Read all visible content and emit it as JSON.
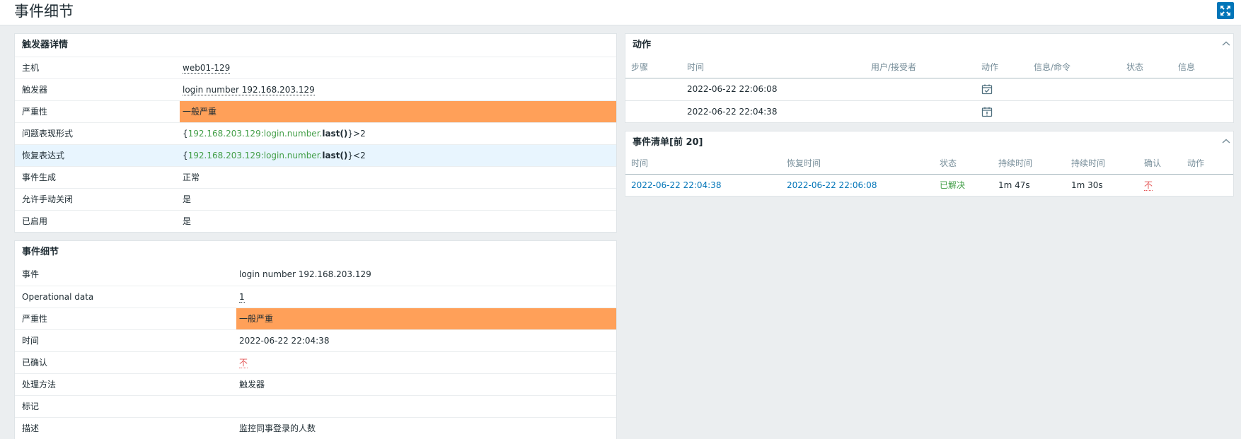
{
  "page": {
    "title": "事件细节"
  },
  "trigger_panel": {
    "title": "触发器详情",
    "rows": [
      {
        "label": "主机",
        "value": "web01-129"
      },
      {
        "label": "触发器",
        "value": "login number 192.168.203.129"
      },
      {
        "label": "严重性",
        "value": "一般严重"
      },
      {
        "label": "问题表现形式",
        "expr_open": "{",
        "expr_key": "192.168.203.129:login.number.",
        "expr_fn": "last()",
        "expr_tail": "}>2"
      },
      {
        "label": "恢复表达式",
        "expr_open": "{",
        "expr_key": "192.168.203.129:login.number.",
        "expr_fn": "last()",
        "expr_tail": "}<2"
      },
      {
        "label": "事件生成",
        "value": "正常"
      },
      {
        "label": "允许手动关闭",
        "value": "是"
      },
      {
        "label": "已启用",
        "value": "是"
      }
    ]
  },
  "event_panel": {
    "title": "事件细节",
    "rows": [
      {
        "label": "事件",
        "value": "login number 192.168.203.129"
      },
      {
        "label": "Operational data",
        "value": "1"
      },
      {
        "label": "严重性",
        "value": "一般严重"
      },
      {
        "label": "时间",
        "value": "2022-06-22 22:04:38"
      },
      {
        "label": "已确认",
        "value": "不"
      },
      {
        "label": "处理方法",
        "value": "触发器"
      },
      {
        "label": "标记",
        "value": ""
      },
      {
        "label": "描述",
        "value": "监控同事登录的人数"
      }
    ]
  },
  "actions_panel": {
    "title": "动作",
    "columns": [
      "步骤",
      "时间",
      "用户/接受者",
      "动作",
      "信息/命令",
      "状态",
      "信息"
    ],
    "rows": [
      {
        "time": "2022-06-22 22:06:08",
        "icon": "calendar-check-icon"
      },
      {
        "time": "2022-06-22 22:04:38",
        "icon": "calendar-alert-icon"
      }
    ]
  },
  "event_list_panel": {
    "title": "事件清单[前 20]",
    "columns": [
      "时间",
      "恢复时间",
      "状态",
      "持续时间",
      "持续时间",
      "确认",
      "动作"
    ],
    "rows": [
      {
        "time": "2022-06-22 22:04:38",
        "recovery_time": "2022-06-22 22:06:08",
        "status": "已解决",
        "duration1": "1m 47s",
        "duration2": "1m 30s",
        "ack": "不"
      }
    ]
  },
  "colors": {
    "severity_average": "#ffa059",
    "ok_green": "#429e47",
    "problem_red": "#e45959",
    "link_blue": "#0275b8",
    "highlight_row": "#e8f5fe"
  }
}
